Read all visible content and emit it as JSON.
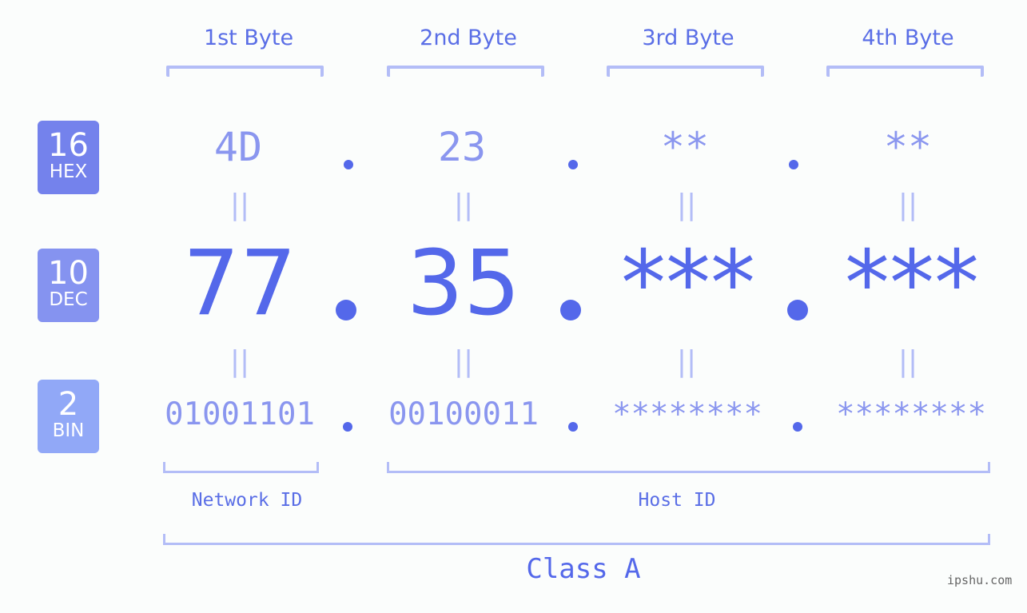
{
  "headers": [
    "1st Byte",
    "2nd Byte",
    "3rd Byte",
    "4th Byte"
  ],
  "badges": [
    {
      "num": "16",
      "label": "HEX",
      "color": "#7482ec"
    },
    {
      "num": "10",
      "label": "DEC",
      "color": "#8593f0"
    },
    {
      "num": "2",
      "label": "BIN",
      "color": "#91a8f7"
    }
  ],
  "hex": [
    "4D",
    "23",
    "**",
    "**"
  ],
  "dec": [
    "77",
    "35",
    "***",
    "***"
  ],
  "bin": [
    "01001101",
    "00100011",
    "********",
    "********"
  ],
  "equals": "=",
  "network_label": "Network ID",
  "host_label": "Host ID",
  "class_label": "Class A",
  "watermark": "ipshu.com"
}
